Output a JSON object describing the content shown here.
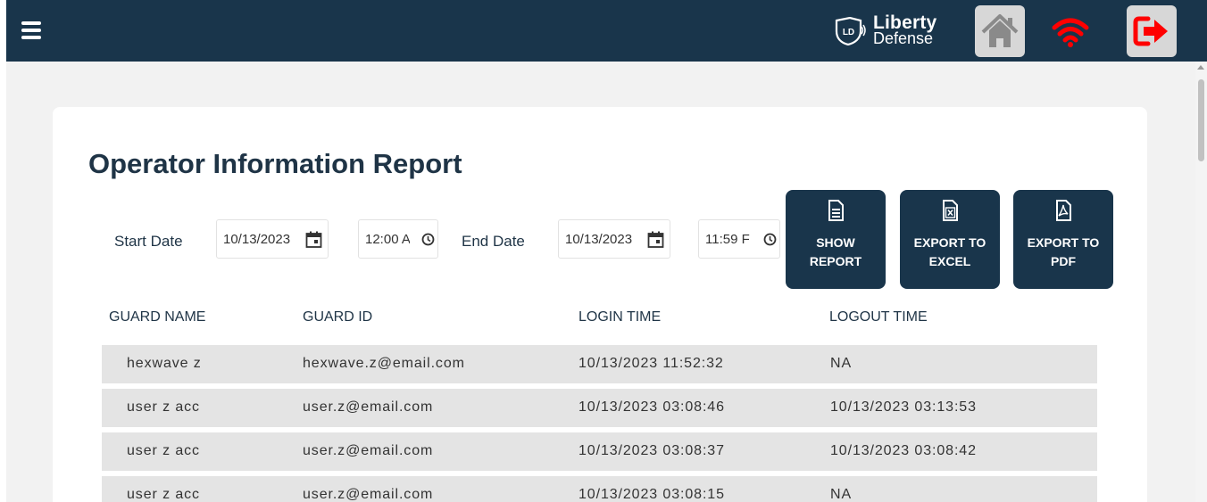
{
  "header": {
    "brand_line1": "Liberty",
    "brand_line2": "Defense",
    "badge_text": "LD",
    "background": "#19354b",
    "alert_color": "#ff0000"
  },
  "icons": {
    "menu": "hamburger-menu-icon",
    "home": "home-icon",
    "wifi": "wifi-icon",
    "logout": "logout-icon",
    "calendar": "calendar-icon",
    "clock": "clock-icon",
    "document": "document-icon",
    "excel": "excel-file-icon",
    "pdf": "pdf-file-icon"
  },
  "report": {
    "title": "Operator Information Report",
    "start_label": "Start Date",
    "start_date": "10/13/2023",
    "start_time": "12:00 A",
    "end_label": "End Date",
    "end_date": "10/13/2023",
    "end_time": "11:59 F"
  },
  "actions": {
    "show_report": "SHOW\nREPORT",
    "export_excel": "EXPORT TO\nEXCEL",
    "export_pdf": "EXPORT TO\nPDF"
  },
  "table": {
    "columns": [
      "GUARD NAME",
      "GUARD ID",
      "LOGIN TIME",
      "LOGOUT TIME"
    ],
    "rows": [
      [
        "hexwave z",
        "hexwave.z@email.com",
        "10/13/2023 11:52:32",
        "NA"
      ],
      [
        "user z acc",
        "user.z@email.com",
        "10/13/2023 03:08:46",
        "10/13/2023 03:13:53"
      ],
      [
        "user z acc",
        "user.z@email.com",
        "10/13/2023 03:08:37",
        "10/13/2023 03:08:42"
      ],
      [
        "user z acc",
        "user.z@email.com",
        "10/13/2023 03:08:15",
        "NA"
      ]
    ]
  }
}
